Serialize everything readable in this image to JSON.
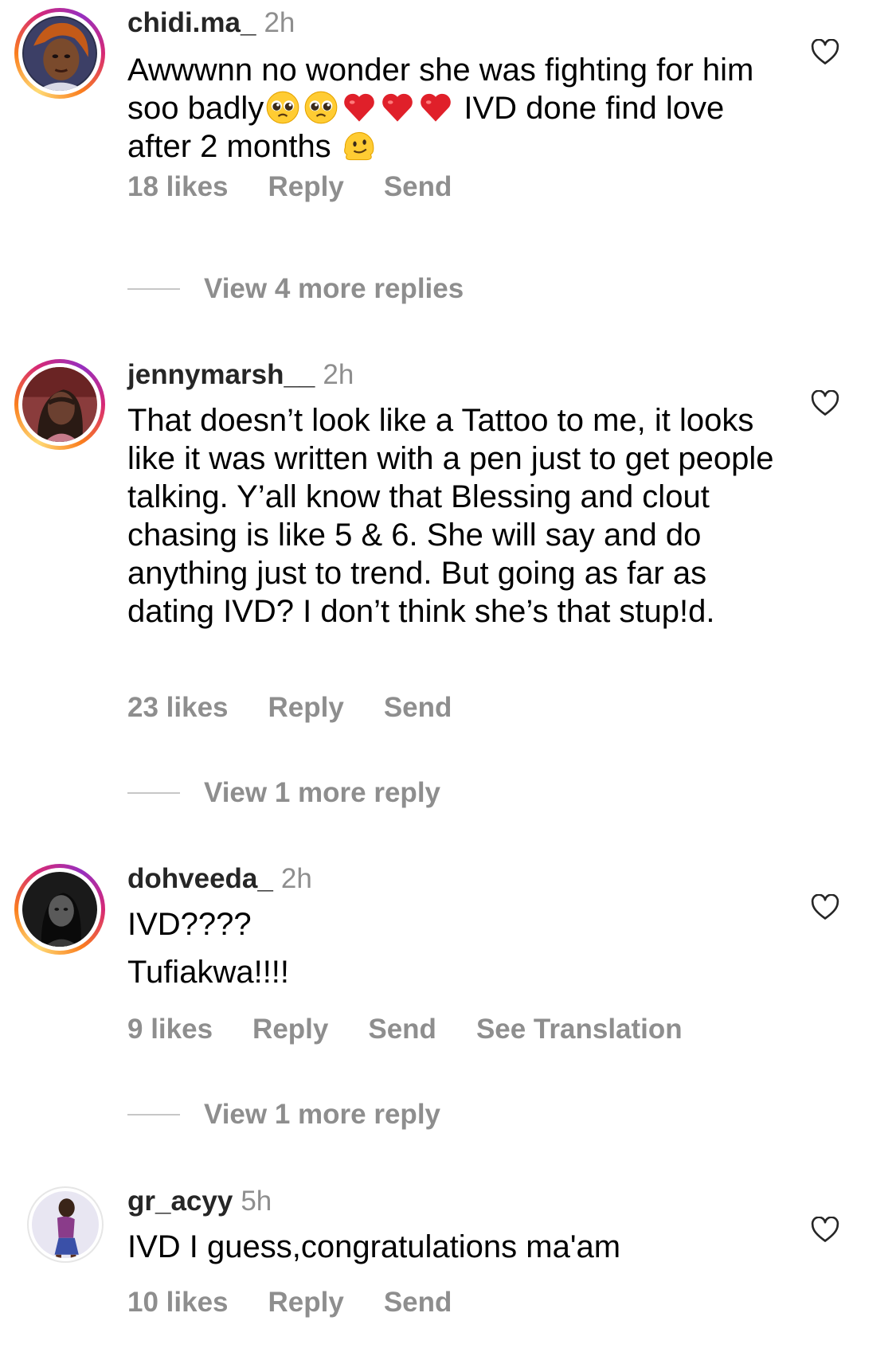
{
  "comments": [
    {
      "username": "chidi.ma_",
      "time": "2h",
      "text_parts": [
        "Awwwnn no wonder she was fighting for him soo badly",
        " IVD done find love after 2 months "
      ],
      "likes": "18 likes",
      "reply": "Reply",
      "send": "Send",
      "view_replies": "View 4 more replies",
      "emojis": [
        "pleading-face",
        "pleading-face",
        "red-heart",
        "red-heart",
        "red-heart",
        "melting-face"
      ]
    },
    {
      "username": "jennymarsh__",
      "time": "2h",
      "text": "That doesn’t look like a Tattoo to me, it looks like it was written with a pen just to get people talking. Y’all know that Blessing and clout chasing is like 5 & 6. She will say and do anything just to trend. But going as far as dating IVD? I don’t think she’s that stup!d.",
      "likes": "23 likes",
      "reply": "Reply",
      "send": "Send",
      "view_replies": "View 1 more reply"
    },
    {
      "username": "dohveeda_",
      "time": "2h",
      "text_line1": "IVD????",
      "text_line2": "Tufiakwa!!!!",
      "likes": "9 likes",
      "reply": "Reply",
      "send": "Send",
      "see_translation": "See Translation",
      "view_replies": "View 1 more reply"
    },
    {
      "username": "gr_acyy",
      "time": "5h",
      "text": "IVD I guess,congratulations ma'am",
      "likes": "10 likes",
      "reply": "Reply",
      "send": "Send"
    }
  ],
  "colors": {
    "secondary_text": "#8e8e8e",
    "username": "#262626",
    "heart_outline": "#262626"
  },
  "icons": {
    "like": "heart-outline-icon"
  }
}
